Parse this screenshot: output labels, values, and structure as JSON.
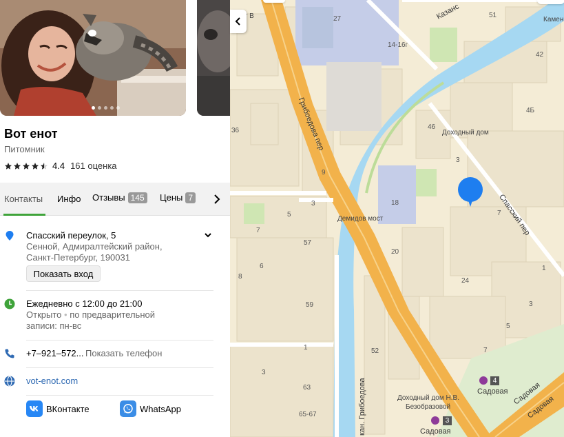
{
  "place": {
    "title": "Вот енот",
    "category": "Питомник",
    "rating": "4.4",
    "rating_count": "161 оценка",
    "stars_filled": 4.4
  },
  "tabs": [
    {
      "label": "Контакты"
    },
    {
      "label": "Инфо"
    },
    {
      "label": "Отзывы",
      "badge": "145"
    },
    {
      "label": "Цены",
      "badge": "7"
    }
  ],
  "address": {
    "line1": "Спасский переулок, 5",
    "line2": "Сенной, Адмиралтейский район,",
    "line3": "Санкт-Петербург, 190031",
    "button": "Показать вход"
  },
  "hours": {
    "line1": "Ежедневно с 12:00 до 21:00",
    "line2": "Открыто",
    "line2_sep": "•",
    "line2_rest": "по предварительной",
    "line3": "записи: пн-вс"
  },
  "phone": {
    "number": "+7–921–572...",
    "show": "Показать телефон"
  },
  "website": "vot-enot.com",
  "socials": [
    {
      "label": "ВКонтакте",
      "icon": "vk-icon",
      "color": "#2787f5"
    },
    {
      "label": "WhatsApp",
      "icon": "whatsapp-icon",
      "color": "#3b8de6"
    }
  ],
  "colors": {
    "accent_green": "#3fa33a",
    "pin_blue": "#1e7ef0",
    "water": "#a6d8f2",
    "road_orange": "#f2b24b",
    "map_bg": "#f4ecd6",
    "building": "#ece3cc"
  },
  "map": {
    "labels": {
      "demidov": "Демидов мост",
      "dohodny1": "Доходный дом",
      "dohodny2_a": "Доходный дом Н.В.",
      "dohodny2_b": "Безобразовой",
      "sadovaya1": "Садовая",
      "sadovaya2": "Садовая",
      "metro4": "4",
      "metro3": "3",
      "kamen": "Камен",
      "kazan": "Казанс",
      "street_v": "стрит В",
      "griboedova_per": "Грибоедова пер",
      "spassky_per": "Спасский пер",
      "griboedova_kan": "кан. Грибоедова",
      "sadovaya_st1": "Садовая",
      "sadovaya_st2": "Садовая"
    },
    "numbers": {
      "n27": "27",
      "n51": "51",
      "n42": "42",
      "n14": "14-16г",
      "n36": "36",
      "n46": "46",
      "n45": "4Б",
      "n3a": "3",
      "n9": "9",
      "n18": "18",
      "n5a": "5",
      "n3b": "3",
      "n7a": "7",
      "n7b": "7",
      "n57": "57",
      "n20": "20",
      "n6": "6",
      "n8": "8",
      "n59": "59",
      "n24": "24",
      "n1a": "1",
      "n3c": "3",
      "n5b": "5",
      "n52": "52",
      "n7c": "7",
      "n3d": "3",
      "n1b": "1",
      "n63": "63",
      "n6567": "65-67"
    }
  }
}
